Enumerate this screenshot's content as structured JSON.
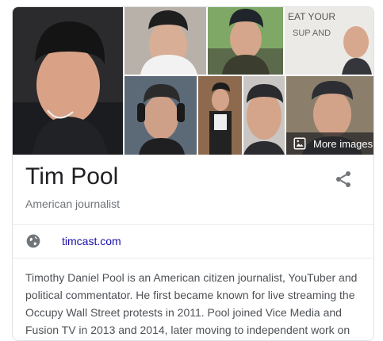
{
  "panel": {
    "title": "Tim Pool",
    "subtitle": "American journalist",
    "more_images_label": "More images",
    "website": {
      "label": "timcast.com"
    },
    "description": "Timothy Daniel Pool is an American citizen journalist, YouTuber and political commentator. He first became known for live streaming the Occupy Wall Street protests in 2011. Pool joined Vice Media and Fusion TV in 2013 and 2014, later moving to independent work on",
    "whiteboard_text": "EAT YOUR SOUP Stop I AM NOT..."
  },
  "colors": {
    "title": "#202124",
    "subtitle": "#70757a",
    "link": "#1a0dab",
    "body_text": "#4d5156",
    "border": "#dfe1e5"
  },
  "icons": [
    "share-icon",
    "globe-icon",
    "image-icon"
  ]
}
